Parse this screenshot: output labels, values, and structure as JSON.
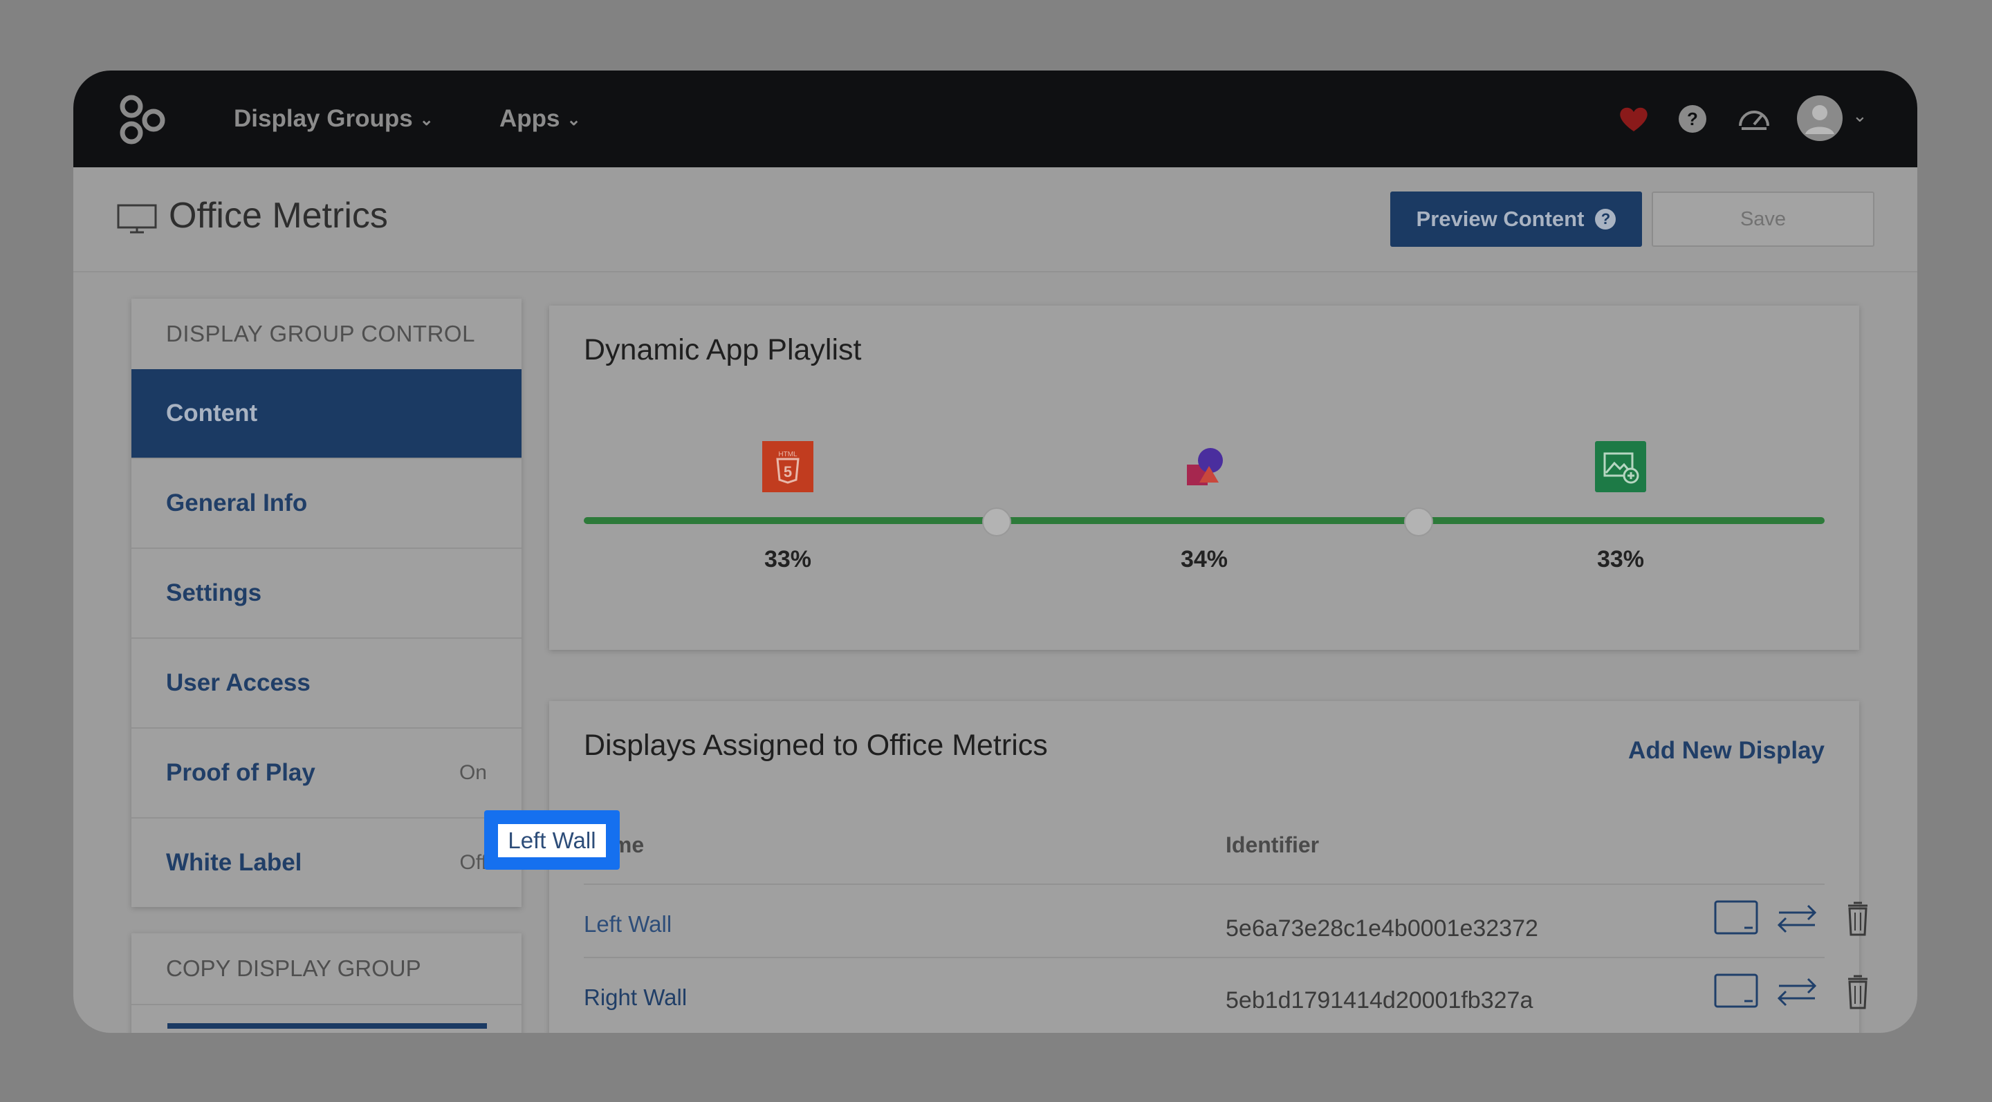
{
  "topbar": {
    "nav": [
      {
        "label": "Display Groups"
      },
      {
        "label": "Apps"
      }
    ],
    "icons": [
      "heart-icon",
      "help-icon",
      "speedometer-icon",
      "avatar"
    ]
  },
  "header": {
    "title": "Office Metrics",
    "preview_label": "Preview Content",
    "preview_help": "?",
    "save_label": "Save"
  },
  "sidebar": {
    "heading": "DISPLAY GROUP CONTROL",
    "items": [
      {
        "label": "Content",
        "status": ""
      },
      {
        "label": "General Info",
        "status": ""
      },
      {
        "label": "Settings",
        "status": ""
      },
      {
        "label": "User Access",
        "status": ""
      },
      {
        "label": "Proof of Play",
        "status": "On"
      },
      {
        "label": "White Label",
        "status": "Off"
      }
    ],
    "copy_heading": "COPY DISPLAY GROUP"
  },
  "playlist": {
    "title": "Dynamic App Playlist",
    "apps": [
      {
        "icon": "html5-icon",
        "percent": "33%"
      },
      {
        "icon": "shapes-icon",
        "percent": "34%"
      },
      {
        "icon": "image-add-icon",
        "percent": "33%"
      }
    ],
    "colors": {
      "track": "#2d7a3a",
      "html5": "#c13c1f",
      "image": "#1d7a46"
    }
  },
  "displays": {
    "title": "Displays Assigned to Office Metrics",
    "add_label": "Add New Display",
    "columns": [
      "Name",
      "Identifier"
    ],
    "rows": [
      {
        "name": "Left Wall",
        "identifier": "5e6a73e28c1e4b0001e32372"
      },
      {
        "name": "Right Wall",
        "identifier": "5eb1d1791414d20001fb327a"
      }
    ]
  },
  "accent": "#1570ef"
}
